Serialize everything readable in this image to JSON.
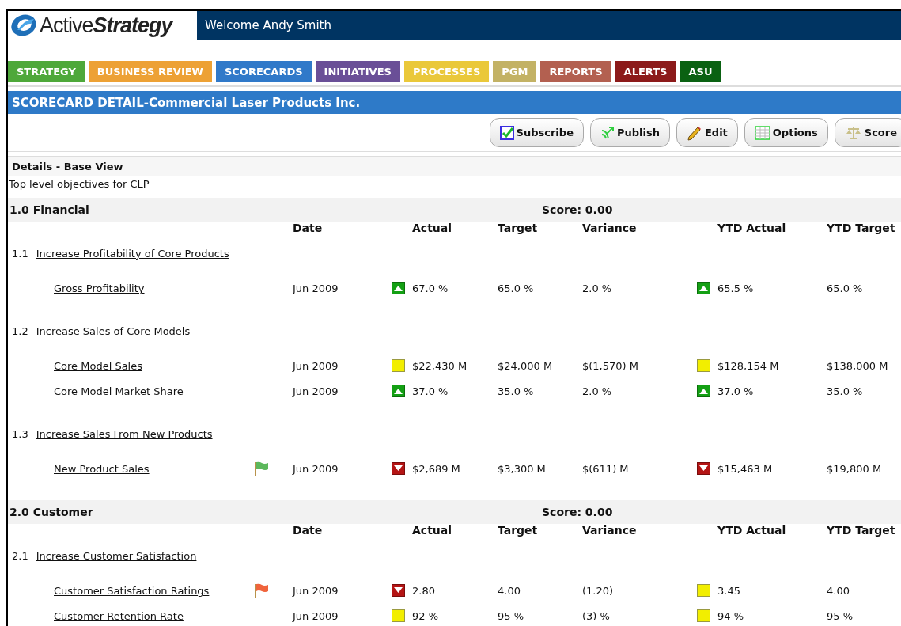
{
  "header": {
    "logo_text": "Active**Strategy**",
    "welcome": "Welcome Andy Smith"
  },
  "nav": [
    {
      "label": "STRATEGY",
      "color": "#4ea83a"
    },
    {
      "label": "BUSINESS REVIEW",
      "color": "#eda135"
    },
    {
      "label": "SCORECARDS",
      "color": "#3079c9"
    },
    {
      "label": "INITIATIVES",
      "color": "#6a4f97"
    },
    {
      "label": "PROCESSES",
      "color": "#eac83a"
    },
    {
      "label": "PGM",
      "color": "#c3b265"
    },
    {
      "label": "REPORTS",
      "color": "#b36050"
    },
    {
      "label": "ALERTS",
      "color": "#8c1a1a"
    },
    {
      "label": "ASU",
      "color": "#0a6112"
    }
  ],
  "title": "SCORECARD DETAIL-Commercial Laser Products Inc.",
  "toolbar": [
    {
      "label": "Subscribe",
      "kind": "subscribe"
    },
    {
      "label": "Publish",
      "kind": "publish"
    },
    {
      "label": "Edit",
      "kind": "edit"
    },
    {
      "label": "Options",
      "kind": "options"
    },
    {
      "label": "Score",
      "kind": "score"
    }
  ],
  "details_title": "Details - Base View",
  "description": "Top level objectives for CLP",
  "sections": [
    {
      "name": "1.0 Financial",
      "score": "Score: 0.00",
      "columns": [
        "Date",
        "Actual",
        "Target",
        "Variance",
        "YTD Actual",
        "YTD Target"
      ],
      "objectives": [
        {
          "number": "1.1",
          "name": "Increase Profitability of Core Products",
          "metrics": [
            {
              "name": "Gross Profitability",
              "date": "Jun 2009",
              "actual": {
                "value": "67.0 %",
                "kind": "up"
              },
              "target": "65.0 %",
              "variance": "2.0 %",
              "ytd_actual": {
                "value": "65.5 %",
                "kind": "up"
              },
              "ytd_target": "65.0 %"
            }
          ]
        },
        {
          "number": "1.2",
          "name": "Increase Sales of Core Models",
          "metrics": [
            {
              "name": "Core Model Sales",
              "date": "Jun 2009",
              "actual": {
                "value": "$22,430 M",
                "kind": "neutral"
              },
              "target": "$24,000 M",
              "variance": "$(1,570) M",
              "ytd_actual": {
                "value": "$128,154 M",
                "kind": "neutral"
              },
              "ytd_target": "$138,000 M"
            },
            {
              "name": "Core Model Market Share",
              "date": "Jun 2009",
              "actual": {
                "value": "37.0 %",
                "kind": "up"
              },
              "target": "35.0 %",
              "variance": "2.0 %",
              "ytd_actual": {
                "value": "37.0 %",
                "kind": "up"
              },
              "ytd_target": "35.0 %"
            }
          ]
        },
        {
          "number": "1.3",
          "name": "Increase Sales From New Products",
          "metrics": [
            {
              "name": "New Product Sales",
              "flag": {
                "color": "#5cb85c"
              },
              "date": "Jun 2009",
              "actual": {
                "value": "$2,689 M",
                "kind": "down"
              },
              "target": "$3,300 M",
              "variance": "$(611) M",
              "ytd_actual": {
                "value": "$15,463 M",
                "kind": "down"
              },
              "ytd_target": "$19,800 M"
            }
          ]
        }
      ]
    },
    {
      "name": "2.0 Customer",
      "score": "Score: 0.00",
      "columns": [
        "Date",
        "Actual",
        "Target",
        "Variance",
        "YTD Actual",
        "YTD Target"
      ],
      "objectives": [
        {
          "number": "2.1",
          "name": "Increase Customer Satisfaction",
          "metrics": [
            {
              "name": "Customer Satisfaction Ratings",
              "flag": {
                "color": "#f0643c"
              },
              "date": "Jun 2009",
              "actual": {
                "value": "2.80",
                "kind": "down"
              },
              "target": "4.00",
              "variance": "(1.20)",
              "ytd_actual": {
                "value": "3.45",
                "kind": "neutral"
              },
              "ytd_target": "4.00"
            },
            {
              "name": "Customer Retention Rate",
              "date": "Jun 2009",
              "actual": {
                "value": "92 %",
                "kind": "neutral"
              },
              "target": "95 %",
              "variance": "(3) %",
              "ytd_actual": {
                "value": "94 %",
                "kind": "neutral"
              },
              "ytd_target": "95 %"
            }
          ]
        }
      ]
    }
  ]
}
